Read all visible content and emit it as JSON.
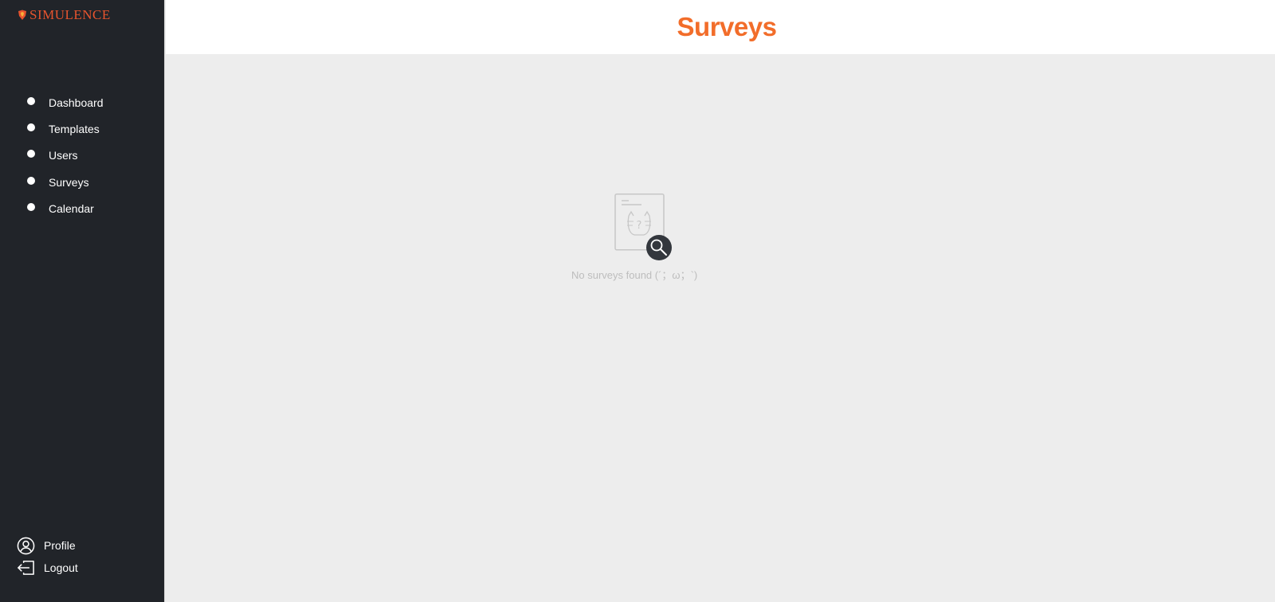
{
  "brand": {
    "name": "SIMULENCE"
  },
  "header": {
    "title": "Surveys"
  },
  "sidebar": {
    "items": [
      {
        "label": "Dashboard"
      },
      {
        "label": "Templates"
      },
      {
        "label": "Users"
      },
      {
        "label": "Surveys"
      },
      {
        "label": "Calendar"
      }
    ],
    "bottom": [
      {
        "label": "Profile",
        "icon": "user-circle-icon"
      },
      {
        "label": "Logout",
        "icon": "logout-icon"
      }
    ]
  },
  "main": {
    "empty_state": {
      "message": "No surveys found (´；ω；`)"
    }
  },
  "colors": {
    "accent": "#f26d2a",
    "brand": "#e8542e",
    "sidebar_bg": "#212429",
    "content_bg": "#ededed"
  }
}
